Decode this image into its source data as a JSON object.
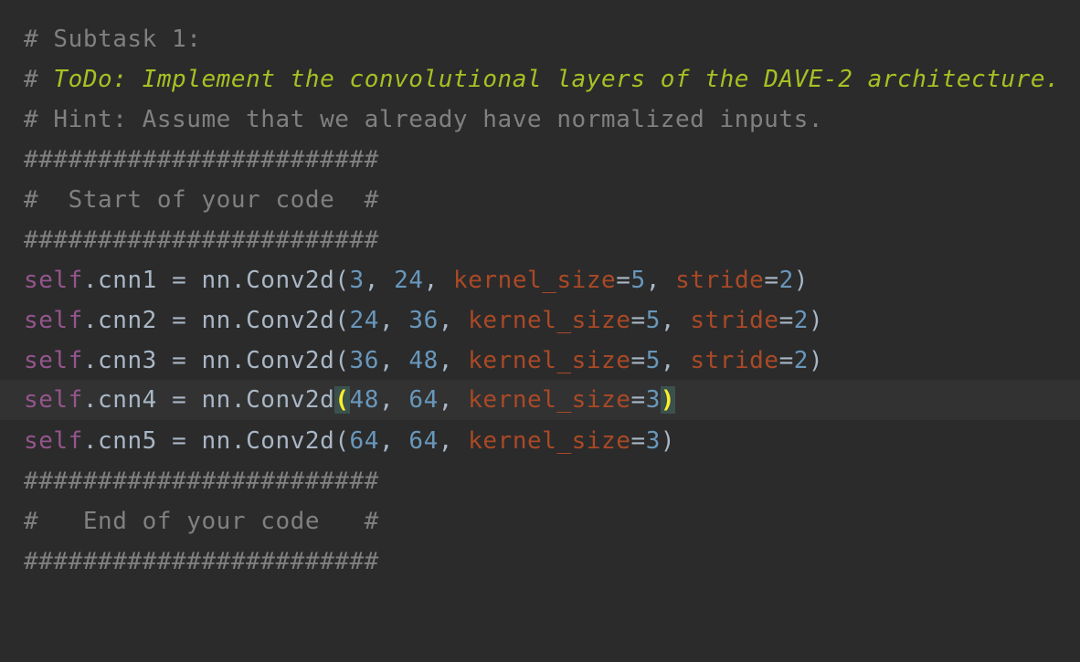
{
  "editor": {
    "colors": {
      "background": "#2b2b2b",
      "current_line": "#323232",
      "comment": "#808080",
      "todo": "#a8c023",
      "self": "#94558d",
      "plain": "#a9b7c6",
      "number": "#6897bb",
      "keyword_arg": "#aa4926",
      "paren_match": "#ffef28"
    },
    "lines": {
      "l1": "# Subtask 1:",
      "l2_hash": "# ",
      "l2_todo": "ToDo: Implement the convolutional layers of the DAVE-2 architecture.",
      "l3": "# Hint: Assume that we already have normalized inputs.",
      "l4": "########################",
      "l5": "#  Start of your code  #",
      "l6": "########################",
      "l12": "########################",
      "l13": "#   End of your code   #",
      "l14": "########################"
    },
    "code": {
      "self_kw": "self",
      "eq_nn": " = nn.Conv2d",
      "open_paren": "(",
      "close_paren": ")",
      "comma": ", ",
      "eq": "=",
      "kernel_size": "kernel_size",
      "stride": "stride",
      "cnn1": ".cnn1",
      "cnn2": ".cnn2",
      "cnn3": ".cnn3",
      "cnn4": ".cnn4",
      "cnn5": ".cnn5",
      "n3": "3",
      "n24": "24",
      "n36": "36",
      "n48": "48",
      "n64": "64",
      "n5": "5",
      "n2": "2"
    }
  }
}
